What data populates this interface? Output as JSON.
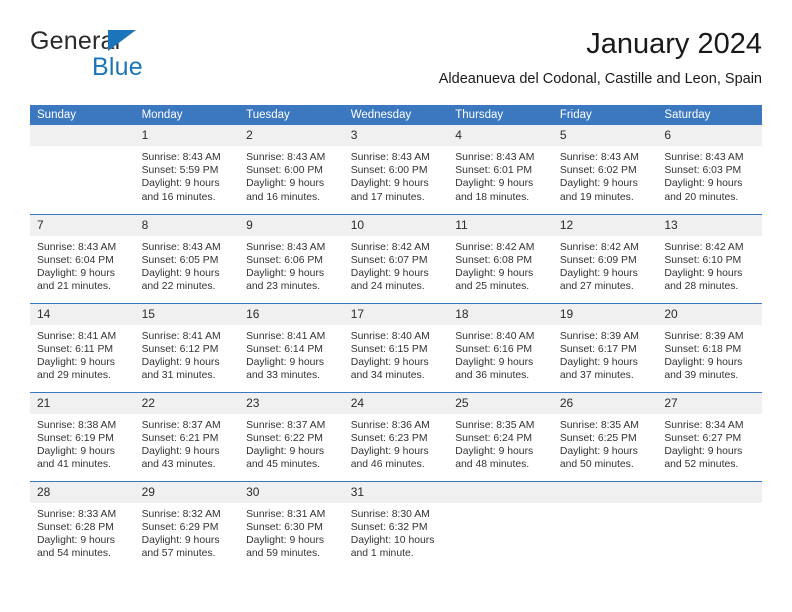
{
  "brand": {
    "line1": "General",
    "line2": "Blue",
    "triangle_color": "#1b75bb"
  },
  "header": {
    "title": "January 2024",
    "subtitle": "Aldeanueva del Codonal, Castille and Leon, Spain"
  },
  "colors": {
    "header_blue": "#3b78c0",
    "daynum_bg": "#f0f0f0",
    "text": "#333333"
  },
  "weekday_headers": [
    "Sunday",
    "Monday",
    "Tuesday",
    "Wednesday",
    "Thursday",
    "Friday",
    "Saturday"
  ],
  "weeks": [
    [
      {
        "day": "",
        "empty": true,
        "sunrise": "",
        "sunset": "",
        "daylight1": "",
        "daylight2": ""
      },
      {
        "day": "1",
        "empty": false,
        "sunrise": "Sunrise: 8:43 AM",
        "sunset": "Sunset: 5:59 PM",
        "daylight1": "Daylight: 9 hours",
        "daylight2": "and 16 minutes."
      },
      {
        "day": "2",
        "empty": false,
        "sunrise": "Sunrise: 8:43 AM",
        "sunset": "Sunset: 6:00 PM",
        "daylight1": "Daylight: 9 hours",
        "daylight2": "and 16 minutes."
      },
      {
        "day": "3",
        "empty": false,
        "sunrise": "Sunrise: 8:43 AM",
        "sunset": "Sunset: 6:00 PM",
        "daylight1": "Daylight: 9 hours",
        "daylight2": "and 17 minutes."
      },
      {
        "day": "4",
        "empty": false,
        "sunrise": "Sunrise: 8:43 AM",
        "sunset": "Sunset: 6:01 PM",
        "daylight1": "Daylight: 9 hours",
        "daylight2": "and 18 minutes."
      },
      {
        "day": "5",
        "empty": false,
        "sunrise": "Sunrise: 8:43 AM",
        "sunset": "Sunset: 6:02 PM",
        "daylight1": "Daylight: 9 hours",
        "daylight2": "and 19 minutes."
      },
      {
        "day": "6",
        "empty": false,
        "sunrise": "Sunrise: 8:43 AM",
        "sunset": "Sunset: 6:03 PM",
        "daylight1": "Daylight: 9 hours",
        "daylight2": "and 20 minutes."
      }
    ],
    [
      {
        "day": "7",
        "empty": false,
        "sunrise": "Sunrise: 8:43 AM",
        "sunset": "Sunset: 6:04 PM",
        "daylight1": "Daylight: 9 hours",
        "daylight2": "and 21 minutes."
      },
      {
        "day": "8",
        "empty": false,
        "sunrise": "Sunrise: 8:43 AM",
        "sunset": "Sunset: 6:05 PM",
        "daylight1": "Daylight: 9 hours",
        "daylight2": "and 22 minutes."
      },
      {
        "day": "9",
        "empty": false,
        "sunrise": "Sunrise: 8:43 AM",
        "sunset": "Sunset: 6:06 PM",
        "daylight1": "Daylight: 9 hours",
        "daylight2": "and 23 minutes."
      },
      {
        "day": "10",
        "empty": false,
        "sunrise": "Sunrise: 8:42 AM",
        "sunset": "Sunset: 6:07 PM",
        "daylight1": "Daylight: 9 hours",
        "daylight2": "and 24 minutes."
      },
      {
        "day": "11",
        "empty": false,
        "sunrise": "Sunrise: 8:42 AM",
        "sunset": "Sunset: 6:08 PM",
        "daylight1": "Daylight: 9 hours",
        "daylight2": "and 25 minutes."
      },
      {
        "day": "12",
        "empty": false,
        "sunrise": "Sunrise: 8:42 AM",
        "sunset": "Sunset: 6:09 PM",
        "daylight1": "Daylight: 9 hours",
        "daylight2": "and 27 minutes."
      },
      {
        "day": "13",
        "empty": false,
        "sunrise": "Sunrise: 8:42 AM",
        "sunset": "Sunset: 6:10 PM",
        "daylight1": "Daylight: 9 hours",
        "daylight2": "and 28 minutes."
      }
    ],
    [
      {
        "day": "14",
        "empty": false,
        "sunrise": "Sunrise: 8:41 AM",
        "sunset": "Sunset: 6:11 PM",
        "daylight1": "Daylight: 9 hours",
        "daylight2": "and 29 minutes."
      },
      {
        "day": "15",
        "empty": false,
        "sunrise": "Sunrise: 8:41 AM",
        "sunset": "Sunset: 6:12 PM",
        "daylight1": "Daylight: 9 hours",
        "daylight2": "and 31 minutes."
      },
      {
        "day": "16",
        "empty": false,
        "sunrise": "Sunrise: 8:41 AM",
        "sunset": "Sunset: 6:14 PM",
        "daylight1": "Daylight: 9 hours",
        "daylight2": "and 33 minutes."
      },
      {
        "day": "17",
        "empty": false,
        "sunrise": "Sunrise: 8:40 AM",
        "sunset": "Sunset: 6:15 PM",
        "daylight1": "Daylight: 9 hours",
        "daylight2": "and 34 minutes."
      },
      {
        "day": "18",
        "empty": false,
        "sunrise": "Sunrise: 8:40 AM",
        "sunset": "Sunset: 6:16 PM",
        "daylight1": "Daylight: 9 hours",
        "daylight2": "and 36 minutes."
      },
      {
        "day": "19",
        "empty": false,
        "sunrise": "Sunrise: 8:39 AM",
        "sunset": "Sunset: 6:17 PM",
        "daylight1": "Daylight: 9 hours",
        "daylight2": "and 37 minutes."
      },
      {
        "day": "20",
        "empty": false,
        "sunrise": "Sunrise: 8:39 AM",
        "sunset": "Sunset: 6:18 PM",
        "daylight1": "Daylight: 9 hours",
        "daylight2": "and 39 minutes."
      }
    ],
    [
      {
        "day": "21",
        "empty": false,
        "sunrise": "Sunrise: 8:38 AM",
        "sunset": "Sunset: 6:19 PM",
        "daylight1": "Daylight: 9 hours",
        "daylight2": "and 41 minutes."
      },
      {
        "day": "22",
        "empty": false,
        "sunrise": "Sunrise: 8:37 AM",
        "sunset": "Sunset: 6:21 PM",
        "daylight1": "Daylight: 9 hours",
        "daylight2": "and 43 minutes."
      },
      {
        "day": "23",
        "empty": false,
        "sunrise": "Sunrise: 8:37 AM",
        "sunset": "Sunset: 6:22 PM",
        "daylight1": "Daylight: 9 hours",
        "daylight2": "and 45 minutes."
      },
      {
        "day": "24",
        "empty": false,
        "sunrise": "Sunrise: 8:36 AM",
        "sunset": "Sunset: 6:23 PM",
        "daylight1": "Daylight: 9 hours",
        "daylight2": "and 46 minutes."
      },
      {
        "day": "25",
        "empty": false,
        "sunrise": "Sunrise: 8:35 AM",
        "sunset": "Sunset: 6:24 PM",
        "daylight1": "Daylight: 9 hours",
        "daylight2": "and 48 minutes."
      },
      {
        "day": "26",
        "empty": false,
        "sunrise": "Sunrise: 8:35 AM",
        "sunset": "Sunset: 6:25 PM",
        "daylight1": "Daylight: 9 hours",
        "daylight2": "and 50 minutes."
      },
      {
        "day": "27",
        "empty": false,
        "sunrise": "Sunrise: 8:34 AM",
        "sunset": "Sunset: 6:27 PM",
        "daylight1": "Daylight: 9 hours",
        "daylight2": "and 52 minutes."
      }
    ],
    [
      {
        "day": "28",
        "empty": false,
        "sunrise": "Sunrise: 8:33 AM",
        "sunset": "Sunset: 6:28 PM",
        "daylight1": "Daylight: 9 hours",
        "daylight2": "and 54 minutes."
      },
      {
        "day": "29",
        "empty": false,
        "sunrise": "Sunrise: 8:32 AM",
        "sunset": "Sunset: 6:29 PM",
        "daylight1": "Daylight: 9 hours",
        "daylight2": "and 57 minutes."
      },
      {
        "day": "30",
        "empty": false,
        "sunrise": "Sunrise: 8:31 AM",
        "sunset": "Sunset: 6:30 PM",
        "daylight1": "Daylight: 9 hours",
        "daylight2": "and 59 minutes."
      },
      {
        "day": "31",
        "empty": false,
        "sunrise": "Sunrise: 8:30 AM",
        "sunset": "Sunset: 6:32 PM",
        "daylight1": "Daylight: 10 hours",
        "daylight2": "and 1 minute."
      },
      {
        "day": "",
        "empty": true,
        "sunrise": "",
        "sunset": "",
        "daylight1": "",
        "daylight2": ""
      },
      {
        "day": "",
        "empty": true,
        "sunrise": "",
        "sunset": "",
        "daylight1": "",
        "daylight2": ""
      },
      {
        "day": "",
        "empty": true,
        "sunrise": "",
        "sunset": "",
        "daylight1": "",
        "daylight2": ""
      }
    ]
  ]
}
